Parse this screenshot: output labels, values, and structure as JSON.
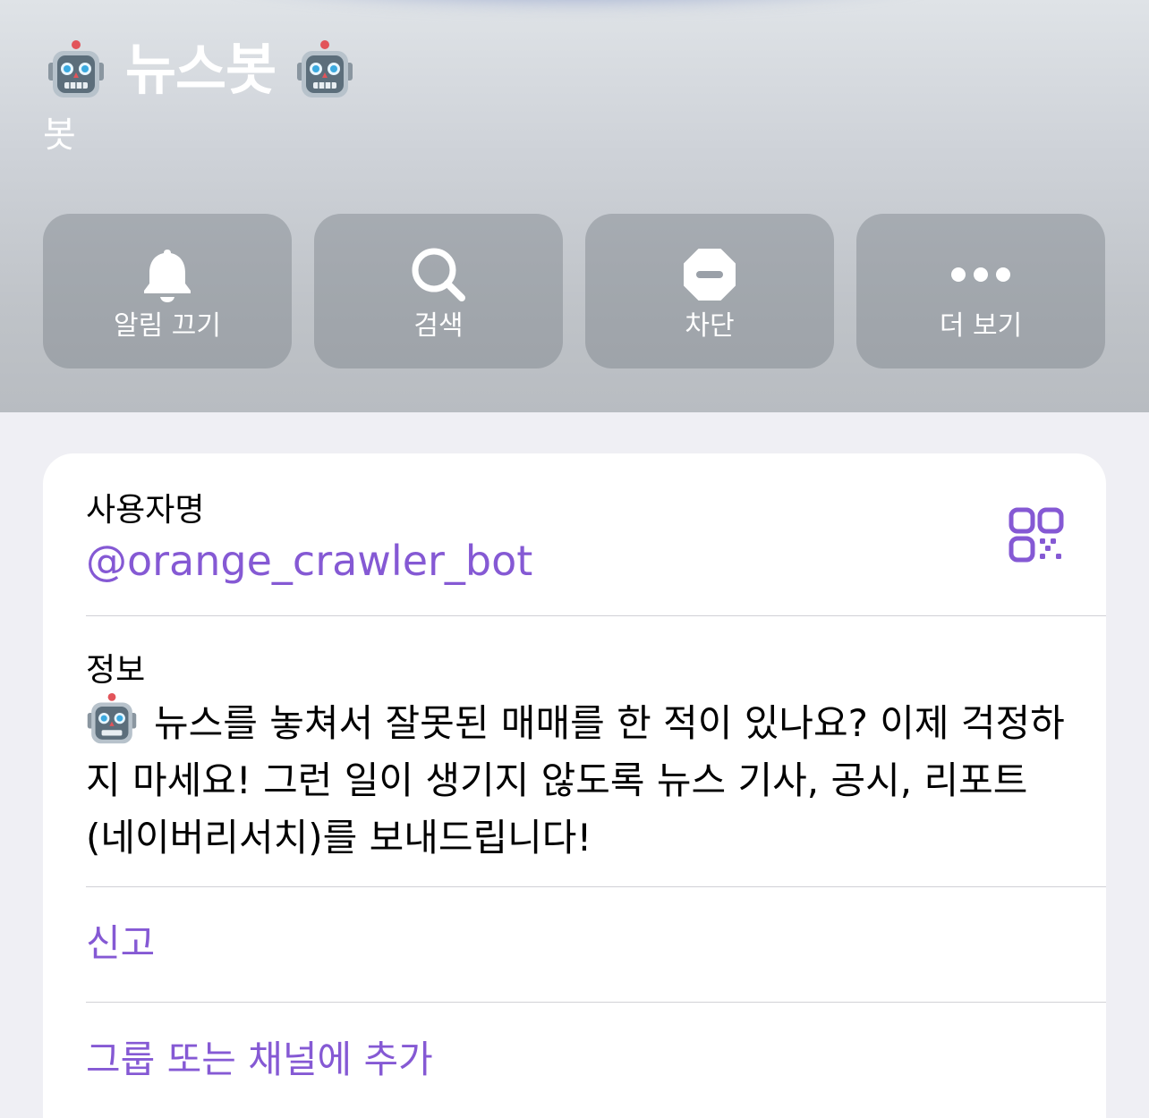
{
  "header": {
    "title": "뉴스봇",
    "subtitle": "봇",
    "title_emoji": "robot-face-icon"
  },
  "actions": [
    {
      "label": "알림 끄기",
      "icon": "bell-icon"
    },
    {
      "label": "검색",
      "icon": "search-icon"
    },
    {
      "label": "차단",
      "icon": "block-icon"
    },
    {
      "label": "더 보기",
      "icon": "more-icon"
    }
  ],
  "info": {
    "username_label": "사용자명",
    "username": "@orange_crawler_bot",
    "about_label": "정보",
    "about_text": "뉴스를 놓쳐서 잘못된 매매를 한 적이 있나요? 이제 걱정하지 마세요! 그런 일이 생기지 않도록 뉴스 기사, 공시, 리포트(네이버리서치)를 보내드립니다!",
    "report_label": "신고",
    "add_label": "그룹 또는 채널에 추가"
  },
  "colors": {
    "accent": "#8559d4",
    "header_bg": "#c8ccd2",
    "page_bg": "#efeff4"
  }
}
